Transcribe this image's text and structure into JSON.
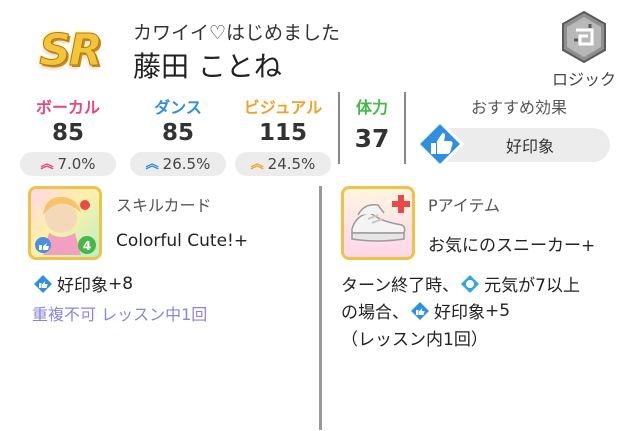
{
  "header": {
    "rarity": "SR",
    "subtitle": "カワイイ♡はじめました",
    "name": "藤田 ことね",
    "plan": {
      "icon": "logic-plan-icon",
      "label": "ロジック"
    }
  },
  "stats": [
    {
      "label": "ボーカル",
      "value": "85",
      "bonus": "7.0%",
      "color": "#e8467c"
    },
    {
      "label": "ダンス",
      "value": "85",
      "bonus": "26.5%",
      "color": "#2f8fe0"
    },
    {
      "label": "ビジュアル",
      "value": "115",
      "bonus": "24.5%",
      "color": "#f0a22a"
    }
  ],
  "stamina": {
    "label": "体力",
    "value": "37",
    "color": "#46b84a"
  },
  "recommended": {
    "label": "おすすめ効果",
    "icon": "good-impression-icon",
    "value": "好印象"
  },
  "skill_card": {
    "type": "スキルカード",
    "name": "Colorful Cute!+",
    "cost": "4",
    "effect_label": "好印象",
    "effect_amount": "+8",
    "note": "重複不可 レッスン中1回"
  },
  "p_item": {
    "type": "Pアイテム",
    "name": "お気にのスニーカー+",
    "line1_prefix": "ターン終了時、",
    "line1_keyword": "元気",
    "line1_suffix": "が7以上",
    "line2_prefix": "の場合、",
    "line2_keyword": "好印象",
    "line2_suffix": "+5",
    "line3": "（レッスン内1回）"
  }
}
